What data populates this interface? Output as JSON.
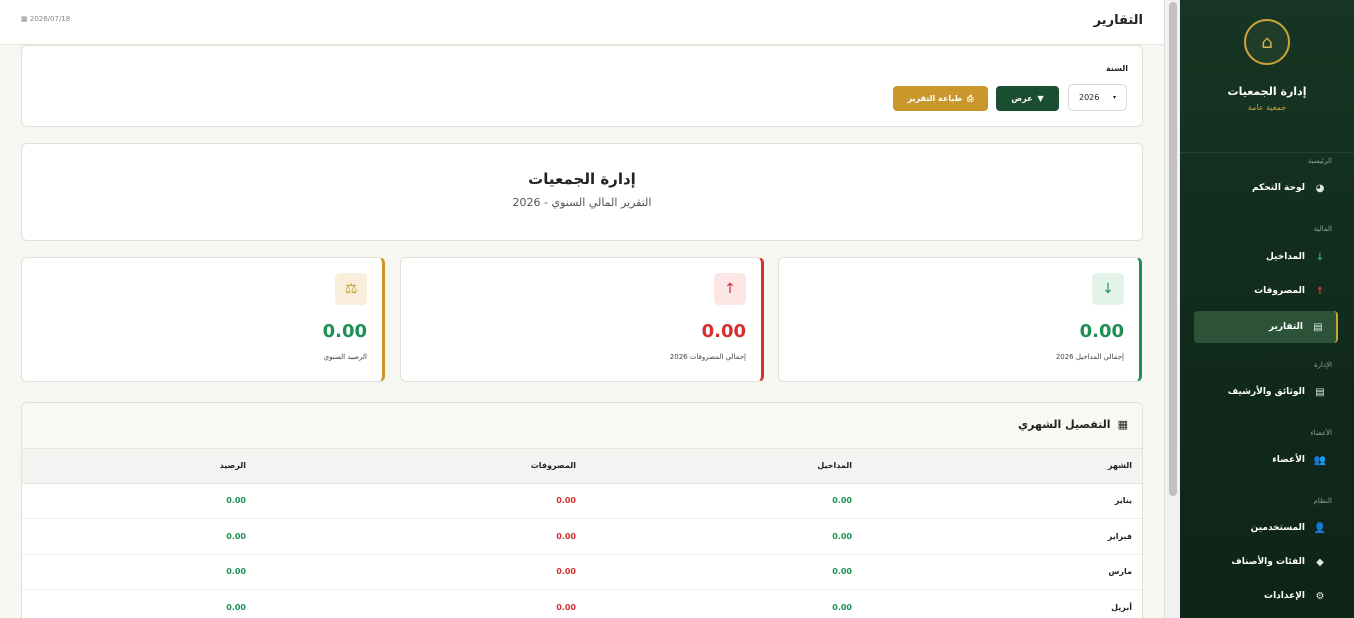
{
  "header": {
    "title": "التقارير",
    "date": "2026/07/18"
  },
  "filters": {
    "year_label": "السنة",
    "year_value": "2026",
    "view_button": "عرض",
    "print_button": "طباعة التقرير"
  },
  "report": {
    "title": "إدارة الجمعيات",
    "subtitle": "التقرير المالي السنوي - 2026"
  },
  "stats": {
    "income": {
      "value": "0.00",
      "label": "إجمالي المداخيل 2026"
    },
    "expenses": {
      "value": "0.00",
      "label": "إجمالي المصروفات 2026"
    },
    "balance": {
      "value": "0.00",
      "label": "الرصيد السنوي"
    }
  },
  "monthly": {
    "title": "التفصيل الشهري",
    "columns": [
      "الشهر",
      "المداخيل",
      "المصروفات",
      "الرصيد"
    ],
    "rows": [
      [
        "يناير",
        "0.00",
        "0.00",
        "0.00"
      ],
      [
        "فبراير",
        "0.00",
        "0.00",
        "0.00"
      ],
      [
        "مارس",
        "0.00",
        "0.00",
        "0.00"
      ],
      [
        "أبريل",
        "0.00",
        "0.00",
        "0.00"
      ]
    ]
  },
  "sidebar": {
    "brand_title": "إدارة الجمعيات",
    "brand_sub": "جمعية عامة",
    "sections": {
      "home": "الرئيسية",
      "finance": "المالية",
      "admin": "الإدارة",
      "members": "الأعضاء",
      "system": "النظام"
    },
    "items": {
      "dashboard": "لوحة التحكم",
      "income": "المداخيل",
      "expenses": "المصروفات",
      "reports": "التقارير",
      "documents": "الوثائق والأرشيف",
      "members": "الأعضاء",
      "users": "المستخدمين",
      "categories": "الفئات والأصناف",
      "settings": "الإعدادات"
    }
  },
  "colors": {
    "sidebar": "#173524",
    "accent": "#c9972c",
    "income": "#1e8f55",
    "expense": "#d32f2f"
  }
}
